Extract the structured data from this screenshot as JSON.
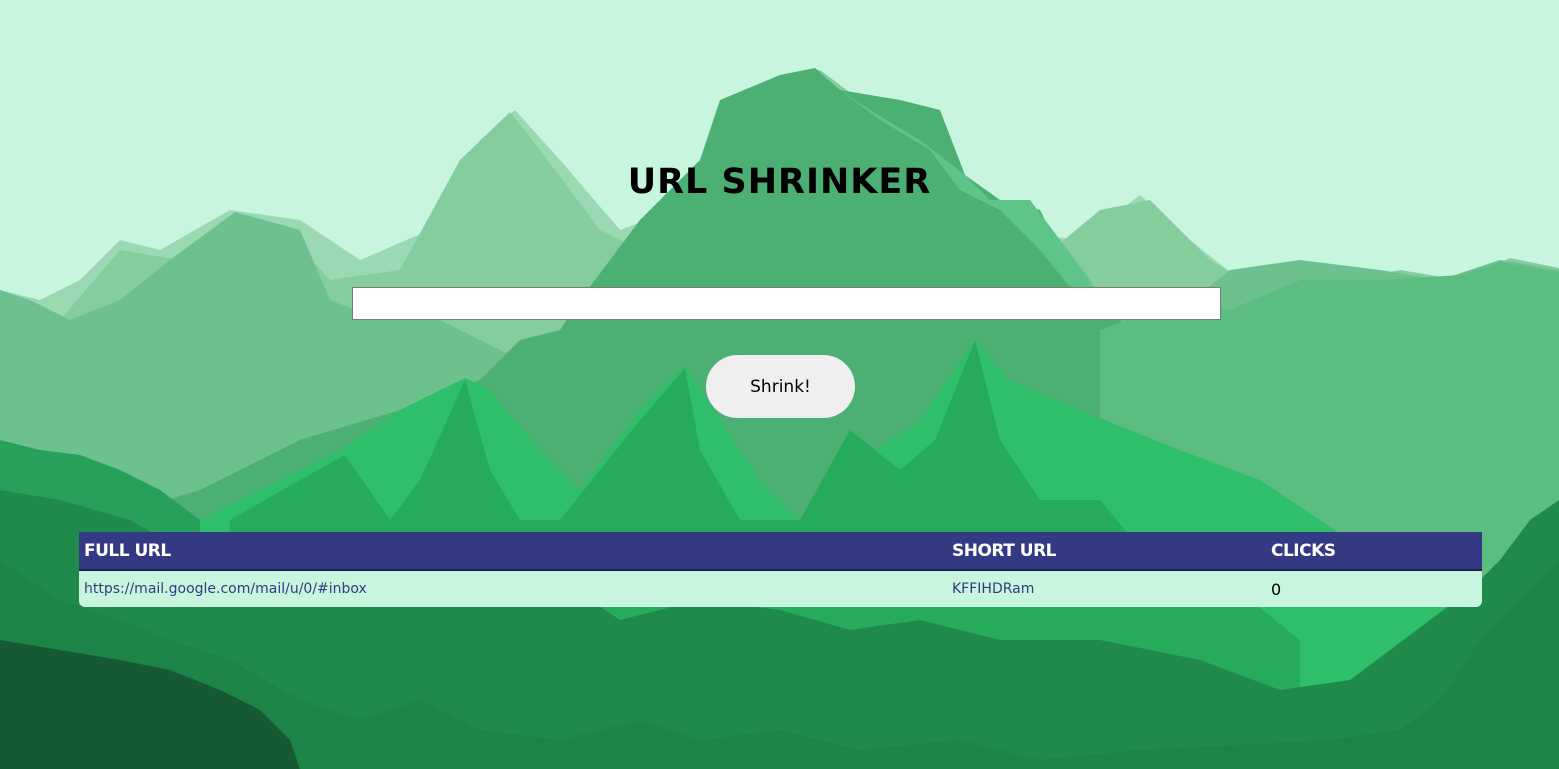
{
  "title": "URL SHRINKER",
  "form": {
    "url_value": "",
    "submit_label": "Shrink!"
  },
  "table": {
    "headers": [
      "FULL URL",
      "SHORT URL",
      "CLICKS"
    ],
    "rows": [
      {
        "full_url": "https://mail.google.com/mail/u/0/#inbox",
        "short_url": "KFFIHDRam",
        "clicks": "0"
      }
    ]
  },
  "colors": {
    "sky": "#c8f5dd",
    "header_bg": "#333a83",
    "link": "#333a83",
    "button_bg": "#efefef"
  },
  "icons": [
    "mountain-background"
  ]
}
